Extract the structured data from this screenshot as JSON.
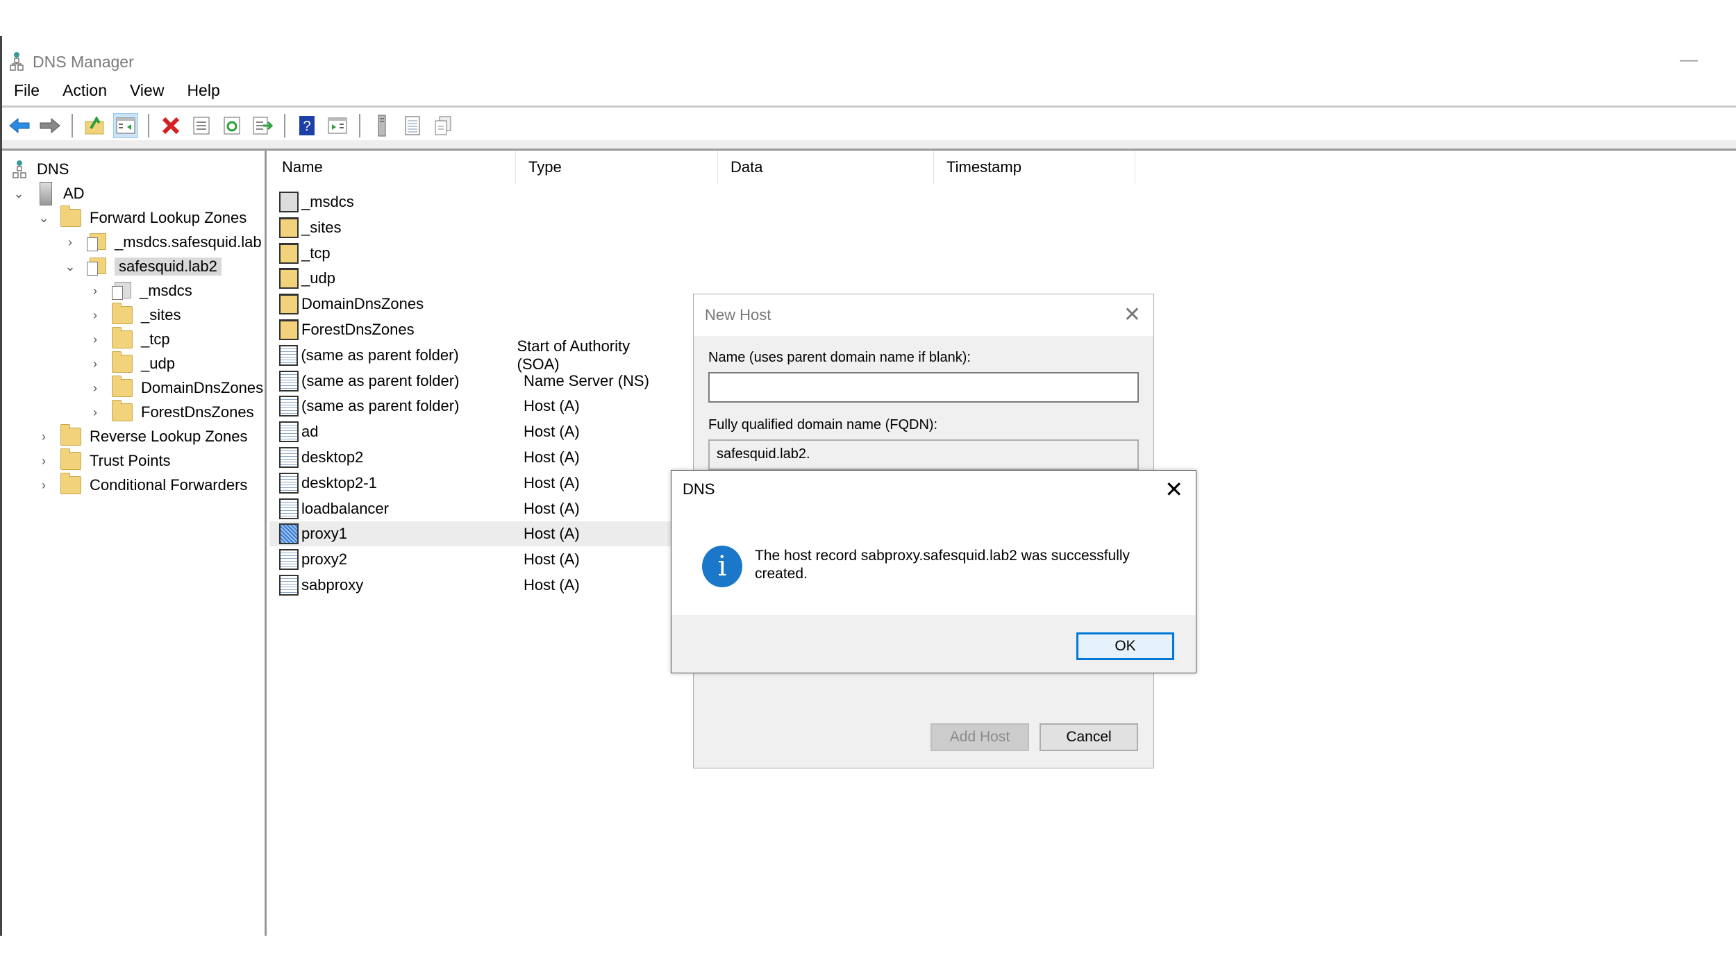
{
  "window": {
    "title": "DNS Manager",
    "minimize_glyph": "—"
  },
  "menu": [
    "File",
    "Action",
    "View",
    "Help"
  ],
  "toolbar": [
    {
      "icon": "back-arrow-icon"
    },
    {
      "icon": "forward-arrow-icon"
    },
    {
      "icon": "up-folder-icon"
    },
    {
      "icon": "show-hide-console-tree-icon",
      "active": true
    },
    {
      "icon": "delete-icon"
    },
    {
      "icon": "properties-icon"
    },
    {
      "icon": "refresh-icon"
    },
    {
      "icon": "export-list-icon"
    },
    {
      "icon": "help-icon"
    },
    {
      "icon": "show-action-pane-icon"
    },
    {
      "icon": "server-icon"
    },
    {
      "icon": "record-list-icon"
    },
    {
      "icon": "copy-record-icon"
    }
  ],
  "tree": {
    "root": "DNS",
    "server": "AD",
    "forward_zones": "Forward Lookup Zones",
    "msdcs_zone": "_msdcs.safesquid.lab",
    "selected_zone": "safesquid.lab2",
    "children": [
      "_msdcs",
      "_sites",
      "_tcp",
      "_udp",
      "DomainDnsZones",
      "ForestDnsZones"
    ],
    "reverse_zones": "Reverse Lookup Zones",
    "trust_points": "Trust Points",
    "conditional_forwarders": "Conditional Forwarders"
  },
  "list": {
    "columns": [
      "Name",
      "Type",
      "Data",
      "Timestamp"
    ],
    "rows": [
      {
        "name": "_msdcs",
        "type": "",
        "icon": "msdcs"
      },
      {
        "name": "_sites",
        "type": "",
        "icon": "folder"
      },
      {
        "name": "_tcp",
        "type": "",
        "icon": "folder"
      },
      {
        "name": "_udp",
        "type": "",
        "icon": "folder"
      },
      {
        "name": "DomainDnsZones",
        "type": "",
        "icon": "folder"
      },
      {
        "name": "ForestDnsZones",
        "type": "",
        "icon": "folder"
      },
      {
        "name": "(same as parent folder)",
        "type": "Start of Authority (SOA)",
        "icon": "record"
      },
      {
        "name": "(same as parent folder)",
        "type": "Name Server (NS)",
        "icon": "record"
      },
      {
        "name": "(same as parent folder)",
        "type": "Host (A)",
        "icon": "record"
      },
      {
        "name": "ad",
        "type": "Host (A)",
        "icon": "record"
      },
      {
        "name": "desktop2",
        "type": "Host (A)",
        "icon": "record"
      },
      {
        "name": "desktop2-1",
        "type": "Host (A)",
        "icon": "record"
      },
      {
        "name": "loadbalancer",
        "type": "Host (A)",
        "icon": "record"
      },
      {
        "name": "proxy1",
        "type": "Host (A)",
        "icon": "record",
        "highlighted": true
      },
      {
        "name": "proxy2",
        "type": "Host (A)",
        "icon": "record"
      },
      {
        "name": "sabproxy",
        "type": "Host (A)",
        "icon": "record"
      }
    ]
  },
  "new_host_dialog": {
    "title": "New Host",
    "name_label": "Name (uses parent domain name if blank):",
    "name_value": "",
    "fqdn_label": "Fully qualified domain name (FQDN):",
    "fqdn_value": "safesquid.lab2.",
    "add_host_label": "Add Host",
    "cancel_label": "Cancel"
  },
  "message_box": {
    "title": "DNS",
    "icon": "info-icon",
    "message": "The host record sabproxy.safesquid.lab2 was successfully created.",
    "ok_label": "OK",
    "close_glyph": "✕"
  },
  "colors": {
    "accent": "#0078d7",
    "info_icon": "#1a77c9",
    "folder": "#f2d27a",
    "selection_grey": "#d9d9d9"
  }
}
